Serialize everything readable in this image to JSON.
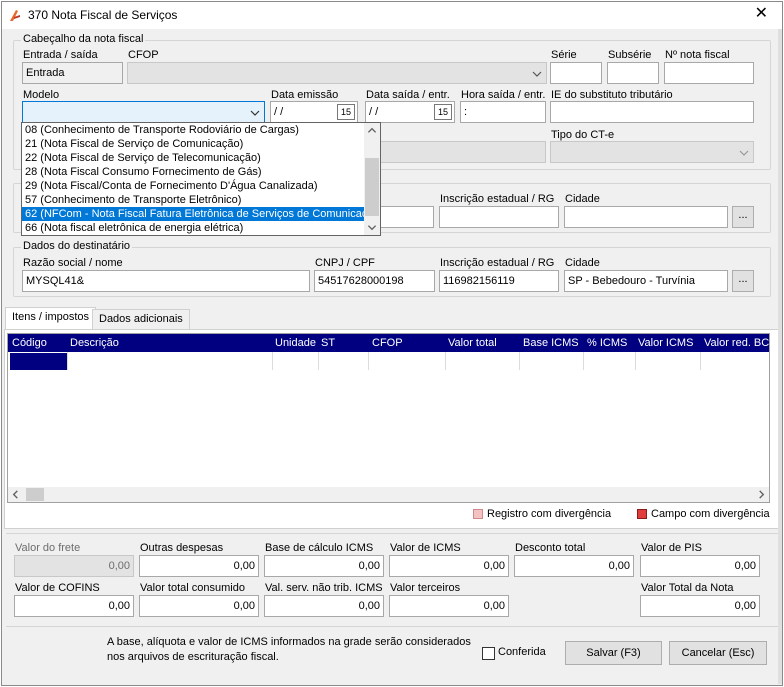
{
  "window": {
    "title": "370 Nota Fiscal de Serviços",
    "close_label": "✕"
  },
  "header_group": {
    "title": "Cabeçalho da nota fiscal",
    "entrada_saida_label": "Entrada / saída",
    "entrada_saida_value": "Entrada",
    "cfop_label": "CFOP",
    "serie_label": "Série",
    "subserie_label": "Subsérie",
    "numero_label": "Nº nota fiscal",
    "modelo_label": "Modelo",
    "data_emissao_label": "Data emissão",
    "data_emissao_value": " / /",
    "data_saida_label": "Data saída / entr.",
    "data_saida_value": " / /",
    "hora_saida_label": "Hora saída / entr.",
    "hora_saida_value": " :",
    "ie_substituto_label": "IE do substituto tributário",
    "tipo_cte_label": "Tipo do CT-e",
    "calendar_label": "15"
  },
  "modelo_dropdown": {
    "items": [
      "08 (Conhecimento de Transporte Rodoviário de Cargas)",
      "21 (Nota Fiscal de Serviço de Comunicação)",
      "22 (Nota Fiscal de Serviço de Telecomunicação)",
      "28 (Nota Fiscal Consumo Fornecimento de Gás)",
      "29 (Nota Fiscal/Conta de Fornecimento D'Água Canalizada)",
      "57 (Conhecimento de Transporte Eletrônico)",
      "62 (NFCom - Nota Fiscal Fatura Eletrônica de Serviços de Comunicação)",
      "66 (Nota fiscal eletrônica de energia elétrica)"
    ],
    "selected_index": 6
  },
  "emitente_group": {
    "ie_label": "Inscrição estadual / RG",
    "cidade_label": "Cidade",
    "dots_label": "..."
  },
  "destinatario_group": {
    "title": "Dados do destinatário",
    "razao_label": "Razão social / nome",
    "razao_value": "MYSQL41&",
    "cnpj_label": "CNPJ / CPF",
    "cnpj_value": "54517628000198",
    "ie_label": "Inscrição estadual / RG",
    "ie_value": "116982156119",
    "cidade_label": "Cidade",
    "cidade_value": "SP - Bebedouro - Turvínia",
    "dots_label": "..."
  },
  "tabs": [
    {
      "label": "Itens / impostos",
      "active": true
    },
    {
      "label": "Dados adicionais",
      "active": false
    }
  ],
  "grid": {
    "columns": [
      "Código",
      "Descrição",
      "Unidade",
      "ST",
      "CFOP",
      "Valor total",
      "Base ICMS",
      "% ICMS",
      "Valor ICMS",
      "Valor red. BC"
    ]
  },
  "legend": {
    "registro_divergencia": "Registro com divergência",
    "campo_divergencia": "Campo com divergência",
    "registro_color": "#f4c2c2",
    "campo_color": "#e03c3c"
  },
  "totals": {
    "valor_frete_label": "Valor do frete",
    "valor_frete_value": "0,00",
    "outras_despesas_label": "Outras despesas",
    "outras_despesas_value": "0,00",
    "base_icms_label": "Base de cálculo ICMS",
    "base_icms_value": "0,00",
    "valor_icms_label": "Valor de ICMS",
    "valor_icms_value": "0,00",
    "desconto_label": "Desconto total",
    "desconto_value": "0,00",
    "valor_pis_label": "Valor de PIS",
    "valor_pis_value": "0,00",
    "cofins_label": "Valor de COFINS",
    "cofins_value": "0,00",
    "total_consumido_label": "Valor total consumido",
    "total_consumido_value": "0,00",
    "nao_trib_label": "Val. serv. não trib. ICMS",
    "nao_trib_value": "0,00",
    "terceiros_label": "Valor terceiros",
    "terceiros_value": "0,00",
    "total_nota_label": "Valor Total da Nota",
    "total_nota_value": "0,00"
  },
  "footer": {
    "info_line1": "A base, alíquota e valor de ICMS informados na grade serão considerados",
    "info_line2": "nos arquivos de escrituração fiscal.",
    "conferida_label": "Conferida",
    "save_label": "Salvar (F3)",
    "cancel_label": "Cancelar (Esc)"
  }
}
